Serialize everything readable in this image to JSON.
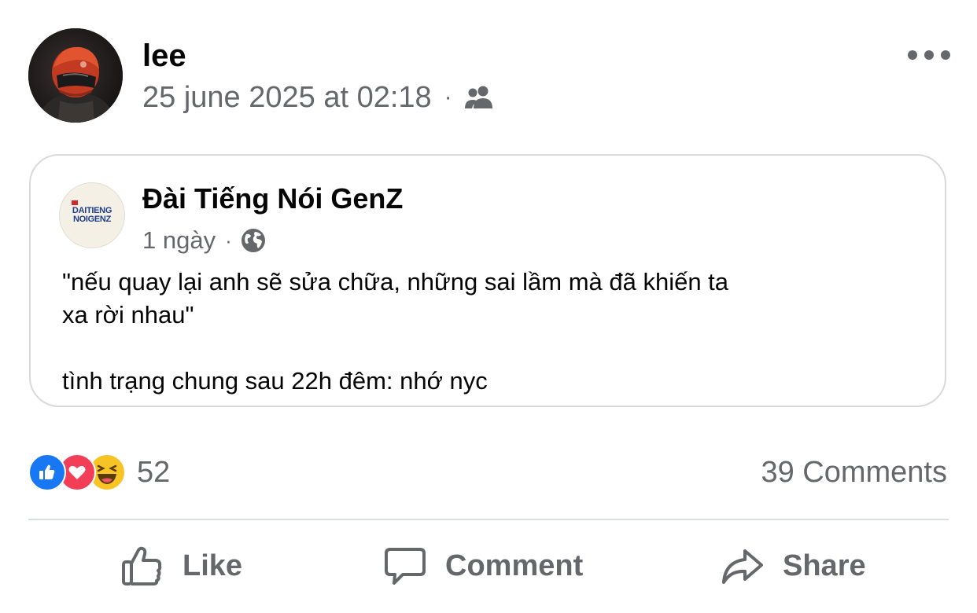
{
  "post": {
    "author": "lee",
    "timestamp": "25 june 2025 at 02:18",
    "separator": "·",
    "audience_icon": "friends-icon",
    "more_icon": "more-horizontal-icon"
  },
  "shared_post": {
    "page_name": "Đài Tiếng Nói GenZ",
    "logo_text_line1": "DAITIENG",
    "logo_text_line2": "NOIGENZ",
    "time": "1 ngày",
    "separator": "·",
    "audience_icon": "globe-icon",
    "text": "\"nếu quay lại anh sẽ sửa chữa, những sai lầm mà đã khiến ta\nxa rời nhau\"\n\ntình trạng chung sau 22h đêm: nhớ nyc"
  },
  "engagement": {
    "reactions": [
      "like",
      "love",
      "haha"
    ],
    "reaction_count": "52",
    "comments_label": "39 Comments"
  },
  "actions": {
    "like_label": "Like",
    "comment_label": "Comment",
    "share_label": "Share"
  },
  "colors": {
    "like_blue": "#1877f2",
    "love_red": "#f33e58",
    "haha_yellow": "#f7c325",
    "secondary_text": "#65676b",
    "divider": "#dadde1"
  }
}
